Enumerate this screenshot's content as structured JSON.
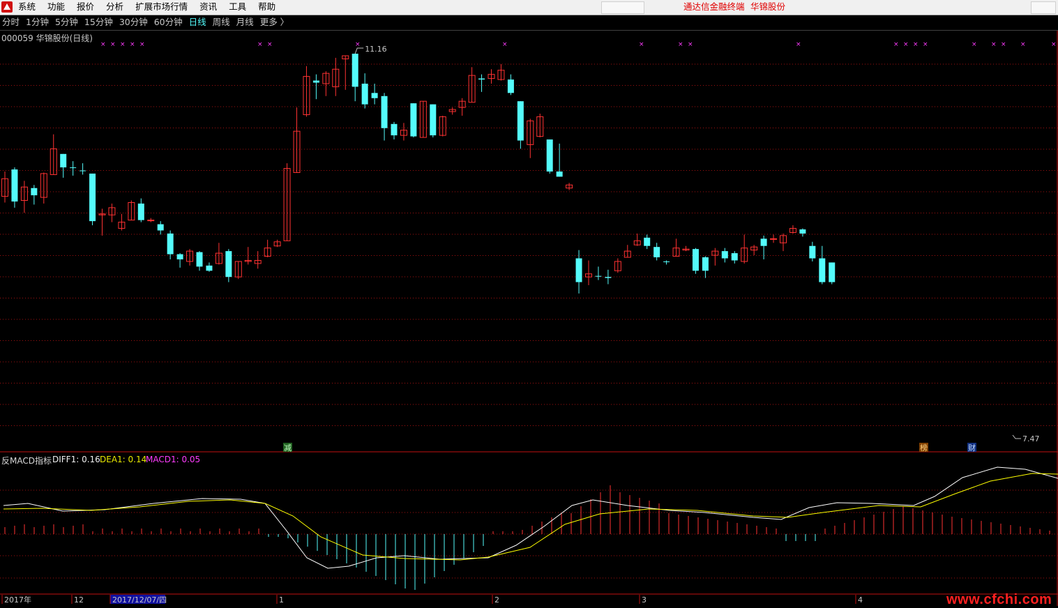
{
  "menu": {
    "items": [
      "系统",
      "功能",
      "报价",
      "分析",
      "扩展市场行情",
      "资讯",
      "工具",
      "帮助"
    ],
    "brand": "通达信金融终端",
    "stock": "华锦股份"
  },
  "periods": {
    "items": [
      "分时",
      "1分钟",
      "5分钟",
      "15分钟",
      "30分钟",
      "60分钟",
      "日线",
      "周线",
      "月线",
      "更多 〉"
    ],
    "active_index": 6
  },
  "stock_title": "000059 华锦股份(日线)",
  "indicator": {
    "name": "反MACD指标",
    "diff": "DIFF1: 0.16",
    "dea": "DEA1: 0.14",
    "macd": "MACD1: 0.05"
  },
  "annotations": {
    "high": "11.16",
    "low": "7.47"
  },
  "event_markers": [
    "减",
    "榜",
    "财"
  ],
  "time_axis": [
    "2017年",
    "12",
    "2017/12/07/四",
    "1",
    "2",
    "3",
    "4"
  ],
  "watermark": "www.cfchi.com",
  "colors": {
    "up": "#ff3232",
    "down": "#54fcfc",
    "diff_line": "#ffffff",
    "dea_line": "#ffff00",
    "grid": "#a01010",
    "marker": "#ff3cff",
    "axis_highlight": "#1010a0"
  },
  "chart_data": {
    "type": "candlestick",
    "high": 11.16,
    "low": 7.47,
    "series": [
      {
        "o": 9.78,
        "c": 9.95,
        "h": 10.02,
        "l": 9.72,
        "up": true
      },
      {
        "o": 10.04,
        "c": 9.73,
        "h": 10.06,
        "l": 9.67,
        "up": false
      },
      {
        "o": 9.74,
        "c": 9.87,
        "h": 9.93,
        "l": 9.62,
        "up": true
      },
      {
        "o": 9.86,
        "c": 9.79,
        "h": 9.89,
        "l": 9.7,
        "up": false
      },
      {
        "o": 9.77,
        "c": 10.0,
        "h": 10.01,
        "l": 9.71,
        "up": true
      },
      {
        "o": 9.99,
        "c": 10.24,
        "h": 10.38,
        "l": 9.99,
        "up": true
      },
      {
        "o": 10.19,
        "c": 10.06,
        "h": 10.19,
        "l": 9.96,
        "up": false
      },
      {
        "o": 10.06,
        "c": 10.06,
        "h": 10.12,
        "l": 9.98,
        "up": false
      },
      {
        "o": 10.03,
        "c": 10.03,
        "h": 10.1,
        "l": 9.99,
        "up": false
      },
      {
        "o": 10.0,
        "c": 9.54,
        "h": 10.0,
        "l": 9.5,
        "up": false
      },
      {
        "o": 9.61,
        "c": 9.6,
        "h": 9.66,
        "l": 9.4,
        "up": true
      },
      {
        "o": 9.6,
        "c": 9.67,
        "h": 9.71,
        "l": 9.53,
        "up": true
      },
      {
        "o": 9.47,
        "c": 9.53,
        "h": 9.61,
        "l": 9.45,
        "up": true
      },
      {
        "o": 9.55,
        "c": 9.72,
        "h": 9.74,
        "l": 9.55,
        "up": true
      },
      {
        "o": 9.71,
        "c": 9.55,
        "h": 9.76,
        "l": 9.53,
        "up": false
      },
      {
        "o": 9.55,
        "c": 9.55,
        "h": 9.57,
        "l": 9.53,
        "up": true
      },
      {
        "o": 9.51,
        "c": 9.45,
        "h": 9.54,
        "l": 9.41,
        "up": false
      },
      {
        "o": 9.42,
        "c": 9.22,
        "h": 9.45,
        "l": 9.17,
        "up": false
      },
      {
        "o": 9.22,
        "c": 9.17,
        "h": 9.23,
        "l": 9.09,
        "up": false
      },
      {
        "o": 9.15,
        "c": 9.25,
        "h": 9.27,
        "l": 9.11,
        "up": true
      },
      {
        "o": 9.24,
        "c": 9.1,
        "h": 9.25,
        "l": 9.06,
        "up": false
      },
      {
        "o": 9.11,
        "c": 9.06,
        "h": 9.14,
        "l": 9.05,
        "up": false
      },
      {
        "o": 9.13,
        "c": 9.23,
        "h": 9.33,
        "l": 9.12,
        "up": true
      },
      {
        "o": 9.25,
        "c": 9.0,
        "h": 9.27,
        "l": 8.95,
        "up": false
      },
      {
        "o": 9.0,
        "c": 9.15,
        "h": 9.15,
        "l": 8.98,
        "up": true
      },
      {
        "o": 9.15,
        "c": 9.16,
        "h": 9.29,
        "l": 9.12,
        "up": true
      },
      {
        "o": 9.16,
        "c": 9.13,
        "h": 9.25,
        "l": 9.08,
        "up": true
      },
      {
        "o": 9.2,
        "c": 9.28,
        "h": 9.36,
        "l": 9.19,
        "up": true
      },
      {
        "o": 9.3,
        "c": 9.34,
        "h": 9.36,
        "l": 9.29,
        "up": true
      },
      {
        "o": 9.35,
        "c": 10.05,
        "h": 10.1,
        "l": 9.35,
        "up": true
      },
      {
        "o": 10.01,
        "c": 10.41,
        "h": 10.64,
        "l": 10.01,
        "up": true
      },
      {
        "o": 10.57,
        "c": 10.94,
        "h": 11.04,
        "l": 10.55,
        "up": true
      },
      {
        "o": 10.9,
        "c": 10.88,
        "h": 10.96,
        "l": 10.72,
        "up": false
      },
      {
        "o": 10.87,
        "c": 10.97,
        "h": 10.99,
        "l": 10.75,
        "up": true
      },
      {
        "o": 10.84,
        "c": 11.01,
        "h": 11.12,
        "l": 10.75,
        "up": true
      },
      {
        "o": 11.11,
        "c": 11.14,
        "h": 11.14,
        "l": 10.81,
        "up": true
      },
      {
        "o": 11.16,
        "c": 10.84,
        "h": 11.16,
        "l": 10.7,
        "up": false
      },
      {
        "o": 10.87,
        "c": 10.67,
        "h": 10.97,
        "l": 10.63,
        "up": false
      },
      {
        "o": 10.78,
        "c": 10.73,
        "h": 10.87,
        "l": 10.67,
        "up": false
      },
      {
        "o": 10.75,
        "c": 10.44,
        "h": 10.78,
        "l": 10.32,
        "up": false
      },
      {
        "o": 10.48,
        "c": 10.37,
        "h": 10.5,
        "l": 10.33,
        "up": false
      },
      {
        "o": 10.37,
        "c": 10.42,
        "h": 10.49,
        "l": 10.32,
        "up": true
      },
      {
        "o": 10.68,
        "c": 10.36,
        "h": 10.68,
        "l": 10.35,
        "up": false
      },
      {
        "o": 10.35,
        "c": 10.7,
        "h": 10.7,
        "l": 10.35,
        "up": true
      },
      {
        "o": 10.67,
        "c": 10.37,
        "h": 10.67,
        "l": 10.35,
        "up": false
      },
      {
        "o": 10.37,
        "c": 10.55,
        "h": 10.56,
        "l": 10.36,
        "up": true
      },
      {
        "o": 10.6,
        "c": 10.62,
        "h": 10.64,
        "l": 10.57,
        "up": true
      },
      {
        "o": 10.64,
        "c": 10.7,
        "h": 10.73,
        "l": 10.56,
        "up": true
      },
      {
        "o": 10.69,
        "c": 10.95,
        "h": 11.03,
        "l": 10.69,
        "up": true
      },
      {
        "o": 10.91,
        "c": 10.92,
        "h": 10.96,
        "l": 10.79,
        "up": false
      },
      {
        "o": 10.92,
        "c": 10.96,
        "h": 11.01,
        "l": 10.87,
        "up": true
      },
      {
        "o": 11.0,
        "c": 10.91,
        "h": 11.06,
        "l": 10.9,
        "up": true
      },
      {
        "o": 10.91,
        "c": 10.78,
        "h": 10.96,
        "l": 10.76,
        "up": false
      },
      {
        "o": 10.7,
        "c": 10.32,
        "h": 10.7,
        "l": 10.24,
        "up": false
      },
      {
        "o": 10.28,
        "c": 10.51,
        "h": 10.53,
        "l": 10.15,
        "up": true
      },
      {
        "o": 10.36,
        "c": 10.55,
        "h": 10.58,
        "l": 10.35,
        "up": true
      },
      {
        "o": 10.33,
        "c": 10.02,
        "h": 10.33,
        "l": 10.0,
        "up": false
      },
      {
        "o": 10.02,
        "c": 9.97,
        "h": 10.29,
        "l": 9.97,
        "up": false
      },
      {
        "o": 9.89,
        "c": 9.86,
        "h": 9.91,
        "l": 9.84,
        "up": true
      },
      {
        "o": 9.18,
        "c": 8.95,
        "h": 9.26,
        "l": 8.84,
        "up": false
      },
      {
        "o": 9.03,
        "c": 9.0,
        "h": 9.16,
        "l": 8.92,
        "up": true
      },
      {
        "o": 9.01,
        "c": 9.01,
        "h": 9.1,
        "l": 8.97,
        "up": false
      },
      {
        "o": 8.99,
        "c": 9.0,
        "h": 9.07,
        "l": 8.93,
        "up": false
      },
      {
        "o": 9.06,
        "c": 9.15,
        "h": 9.18,
        "l": 9.04,
        "up": true
      },
      {
        "o": 9.19,
        "c": 9.25,
        "h": 9.31,
        "l": 9.19,
        "up": true
      },
      {
        "o": 9.31,
        "c": 9.35,
        "h": 9.42,
        "l": 9.3,
        "up": true
      },
      {
        "o": 9.38,
        "c": 9.3,
        "h": 9.41,
        "l": 9.27,
        "up": false
      },
      {
        "o": 9.29,
        "c": 9.19,
        "h": 9.33,
        "l": 9.16,
        "up": false
      },
      {
        "o": 9.15,
        "c": 9.15,
        "h": 9.16,
        "l": 9.12,
        "up": false
      },
      {
        "o": 9.2,
        "c": 9.28,
        "h": 9.37,
        "l": 9.2,
        "up": true
      },
      {
        "o": 9.27,
        "c": 9.26,
        "h": 9.3,
        "l": 9.25,
        "up": true
      },
      {
        "o": 9.27,
        "c": 9.06,
        "h": 9.28,
        "l": 9.03,
        "up": false
      },
      {
        "o": 9.19,
        "c": 9.06,
        "h": 9.2,
        "l": 8.99,
        "up": false
      },
      {
        "o": 9.21,
        "c": 9.25,
        "h": 9.28,
        "l": 9.11,
        "up": true
      },
      {
        "o": 9.25,
        "c": 9.18,
        "h": 9.28,
        "l": 9.14,
        "up": false
      },
      {
        "o": 9.23,
        "c": 9.16,
        "h": 9.25,
        "l": 9.13,
        "up": false
      },
      {
        "o": 9.15,
        "c": 9.28,
        "h": 9.41,
        "l": 9.13,
        "up": true
      },
      {
        "o": 9.29,
        "c": 9.26,
        "h": 9.31,
        "l": 9.21,
        "up": true
      },
      {
        "o": 9.37,
        "c": 9.3,
        "h": 9.4,
        "l": 9.17,
        "up": false
      },
      {
        "o": 9.37,
        "c": 9.37,
        "h": 9.41,
        "l": 9.33,
        "up": true
      },
      {
        "o": 9.33,
        "c": 9.4,
        "h": 9.42,
        "l": 9.25,
        "up": true
      },
      {
        "o": 9.47,
        "c": 9.43,
        "h": 9.5,
        "l": 9.42,
        "up": true
      },
      {
        "o": 9.46,
        "c": 9.42,
        "h": 9.47,
        "l": 9.39,
        "up": false
      },
      {
        "o": 9.3,
        "c": 9.18,
        "h": 9.34,
        "l": 9.15,
        "up": false
      },
      {
        "o": 9.18,
        "c": 8.95,
        "h": 9.3,
        "l": 8.93,
        "up": false
      },
      {
        "o": 9.14,
        "c": 8.95,
        "h": 9.14,
        "l": 8.93,
        "up": false
      }
    ]
  }
}
